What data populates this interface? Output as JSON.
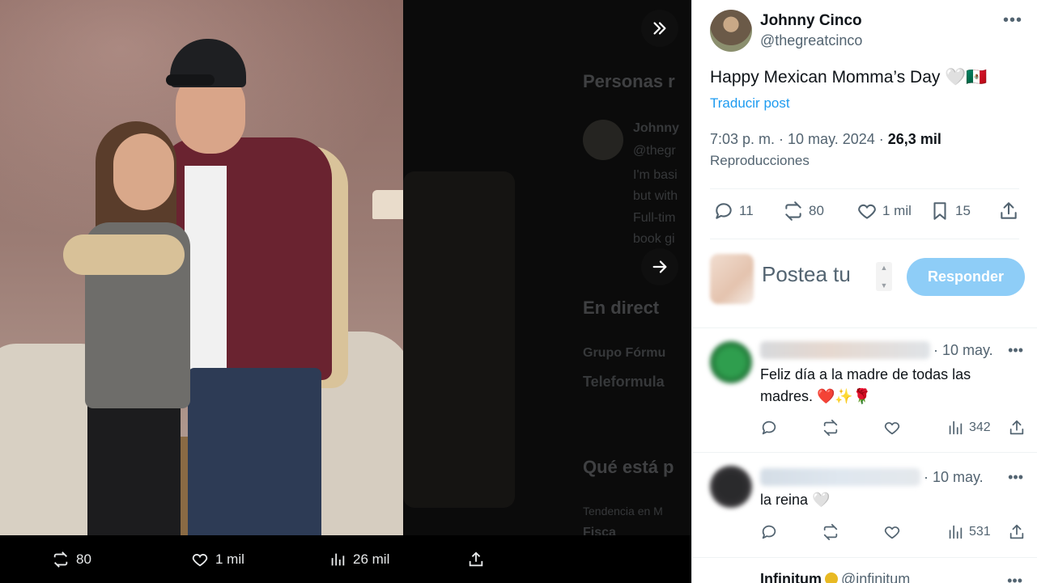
{
  "media_viewer": {
    "actions": {
      "reposts": "80",
      "likes": "1 mil",
      "views": "26 mil"
    }
  },
  "background_page": {
    "heading_people": "Personas r",
    "person_name": "Johnny",
    "person_handle": "@thegr",
    "bio_line1": "I'm basi",
    "bio_line2": "but with",
    "bio_line3": "Full-tim",
    "bio_line4": "book gi",
    "heading_live": "En direct",
    "live_source": "Grupo Fórmu",
    "live_title": "Teleformula",
    "heading_trending": "Qué está p",
    "trending_context": "Tendencia en M",
    "trending_topic": "Fisca"
  },
  "post": {
    "author_name": "Johnny Cinco",
    "author_handle": "@thegreatcinco",
    "text": "Happy Mexican Momma’s Day 🤍🇲🇽",
    "translate_label": "Traducir post",
    "time": "7:03 p. m. · 10 may. 2024 · ",
    "views_count": "26,3 mil",
    "views_label": "Reproducciones",
    "replies": "11",
    "reposts": "80",
    "likes": "1 mil",
    "bookmarks": "15"
  },
  "reply_composer": {
    "placeholder": "Postea tu",
    "button_label": "Responder"
  },
  "replies": [
    {
      "date": "· 10 may.",
      "text": "Feliz día a la madre de todas las madres. ❤️✨🌹",
      "views": "342"
    },
    {
      "date": "· 10 may.",
      "text": "la reina 🤍",
      "views": "531"
    }
  ],
  "next_reply": {
    "name": "Infinitum",
    "handle": "@infinitum"
  },
  "colors": {
    "accent": "#1d9bf0",
    "button_disabled": "#8ecdf7",
    "text_primary": "#0f1419",
    "text_secondary": "#536471"
  }
}
